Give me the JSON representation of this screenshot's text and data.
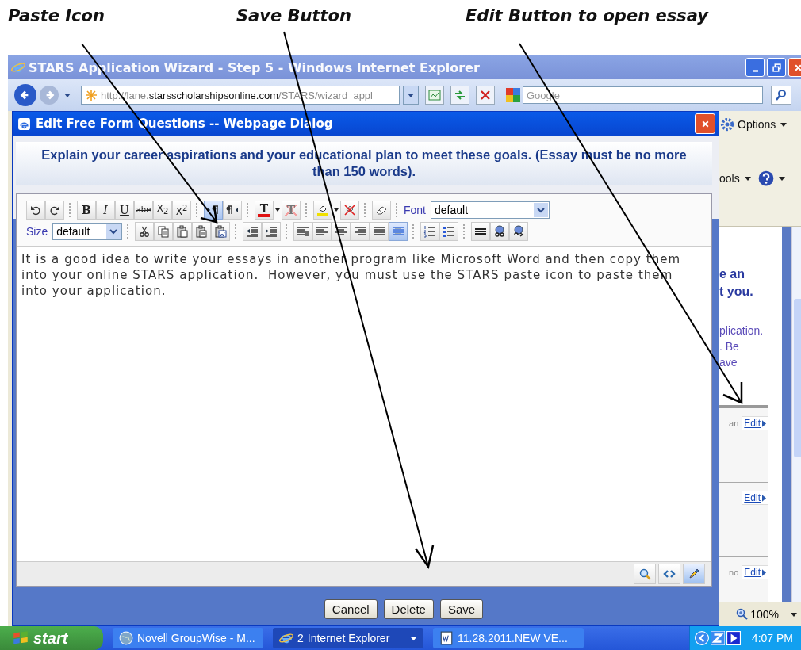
{
  "annotations": [
    {
      "text": "Paste Icon"
    },
    {
      "text": "Save Button"
    },
    {
      "text": "Edit Button to open essay"
    }
  ],
  "browser": {
    "title": "STARS Application Wizard - Step 5 - Windows Internet Explorer",
    "address_prefix": "http://lane.",
    "address_domain": "starsscholarshipsonline.com",
    "address_path": "/STARS/wizard_appl",
    "search_placeholder": "Google",
    "options_label": "Options",
    "tools_label": "ools",
    "page_heading": [
      "e an",
      "t you."
    ],
    "page_text": [
      "plication.",
      ". Be",
      "ave"
    ],
    "list_rows": [
      {
        "fragment": "an",
        "link": "Edit"
      },
      {
        "link": "Edit"
      },
      {
        "fragment": "no",
        "link": "Edit"
      }
    ],
    "zoom": "100%"
  },
  "dialog": {
    "title": "Edit Free Form Questions -- Webpage Dialog",
    "prompt": "Explain your career aspirations and your educational plan to meet these goals. (Essay must be no more than 150 words).",
    "toolbar_rows": [
      [
        {
          "kind": "group",
          "buttons": [
            {
              "kind": "undo",
              "selected": false
            },
            {
              "kind": "redo",
              "selected": false
            }
          ]
        },
        {
          "kind": "group",
          "buttons": [
            {
              "kind": "bold",
              "label": "B",
              "selected": false
            },
            {
              "kind": "italic",
              "label": "I",
              "selected": false
            },
            {
              "kind": "underline",
              "label": "U",
              "selected": false
            },
            {
              "kind": "strike",
              "label": "abe",
              "selected": false
            },
            {
              "kind": "subscript",
              "label": "X$_{2}$",
              "selected": false
            },
            {
              "kind": "superscript",
              "label": "X$^{2}$",
              "selected": false
            }
          ]
        },
        {
          "kind": "group",
          "buttons": [
            {
              "kind": "ltr",
              "selected": true
            },
            {
              "kind": "rtl",
              "selected": false
            }
          ]
        },
        {
          "kind": "group",
          "buttons": [
            {
              "kind": "text-color",
              "label": "T",
              "selected": false
            },
            {
              "kind": "remove-color",
              "label": "T",
              "selected": false
            }
          ]
        },
        {
          "kind": "group",
          "buttons": [
            {
              "kind": "highlight",
              "selected": false
            },
            {
              "kind": "remove-highlight",
              "selected": false
            }
          ]
        },
        {
          "kind": "group",
          "buttons": [
            {
              "kind": "eraser",
              "selected": false
            }
          ]
        },
        {
          "kind": "select",
          "label": "Font",
          "value": "default"
        }
      ],
      [
        {
          "kind": "select",
          "label": "Size",
          "value": "default"
        },
        {
          "kind": "group",
          "buttons": [
            {
              "kind": "cut",
              "selected": false
            },
            {
              "kind": "copy",
              "selected": false
            },
            {
              "kind": "paste",
              "selected": false
            },
            {
              "kind": "paste-text",
              "selected": false
            },
            {
              "kind": "paste-word",
              "selected": false
            }
          ]
        },
        {
          "kind": "group",
          "buttons": [
            {
              "kind": "outdent",
              "selected": false
            },
            {
              "kind": "indent",
              "selected": false
            }
          ]
        },
        {
          "kind": "group",
          "buttons": [
            {
              "kind": "paragraph",
              "selected": false
            },
            {
              "kind": "align-left",
              "selected": false
            },
            {
              "kind": "align-center",
              "selected": false
            },
            {
              "kind": "align-right",
              "selected": false
            },
            {
              "kind": "justify",
              "selected": false
            },
            {
              "kind": "wrap",
              "selected": true
            }
          ]
        },
        {
          "kind": "group",
          "buttons": [
            {
              "kind": "ordered-list",
              "selected": false
            },
            {
              "kind": "bullet-list",
              "selected": false
            }
          ]
        },
        {
          "kind": "group",
          "buttons": [
            {
              "kind": "rule",
              "selected": false
            },
            {
              "kind": "link",
              "selected": false
            },
            {
              "kind": "unlink",
              "selected": false
            }
          ]
        }
      ]
    ],
    "essay": "It is a good idea to write your essays in another program like Microsoft Word and then copy them into your online STARS application.  However, you must use the STARS paste icon to paste them into your application.",
    "view_modes": [
      {
        "kind": "preview",
        "selected": false
      },
      {
        "kind": "html",
        "selected": false
      },
      {
        "kind": "design",
        "selected": true
      }
    ],
    "buttons": [
      "Cancel",
      "Delete",
      "Save"
    ]
  },
  "taskbar": {
    "start": "start",
    "tasks": [
      {
        "kind": "globe",
        "label": "Novell GroupWise - M...",
        "selected": false
      },
      {
        "kind": "browser",
        "count": "2",
        "label": "Internet Explorer",
        "selected": true
      },
      {
        "kind": "document",
        "label": "11.28.2011.NEW VE...",
        "selected": false
      }
    ],
    "clock": "4:07 PM"
  }
}
